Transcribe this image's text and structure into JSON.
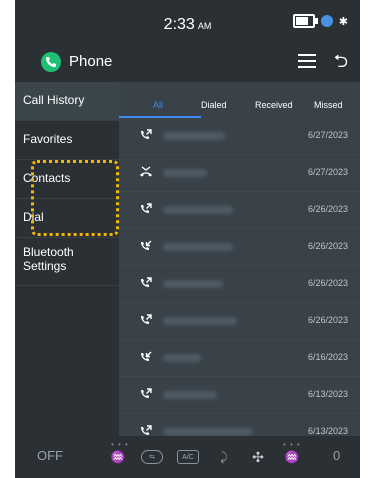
{
  "status": {
    "time": "2:33",
    "ampm": "AM"
  },
  "header": {
    "title": "Phone"
  },
  "sidebar": {
    "items": [
      {
        "label": "Call History"
      },
      {
        "label": "Favorites"
      },
      {
        "label": "Contacts"
      },
      {
        "label": "Dial"
      },
      {
        "label": "Bluetooth Settings"
      }
    ]
  },
  "tabs": [
    "All",
    "Dialed",
    "Received",
    "Missed"
  ],
  "calls": [
    {
      "date": "6/27/2023",
      "type": "outgoing"
    },
    {
      "date": "6/27/2023",
      "type": "missed"
    },
    {
      "date": "6/26/2023",
      "type": "outgoing"
    },
    {
      "date": "6/26/2023",
      "type": "incoming"
    },
    {
      "date": "6/26/2023",
      "type": "outgoing"
    },
    {
      "date": "6/26/2023",
      "type": "outgoing"
    },
    {
      "date": "6/16/2023",
      "type": "incoming"
    },
    {
      "date": "6/13/2023",
      "type": "outgoing"
    },
    {
      "date": "6/13/2023",
      "type": "outgoing"
    }
  ],
  "bottombar": {
    "left": "OFF",
    "right": "0",
    "ac": "A/C"
  }
}
